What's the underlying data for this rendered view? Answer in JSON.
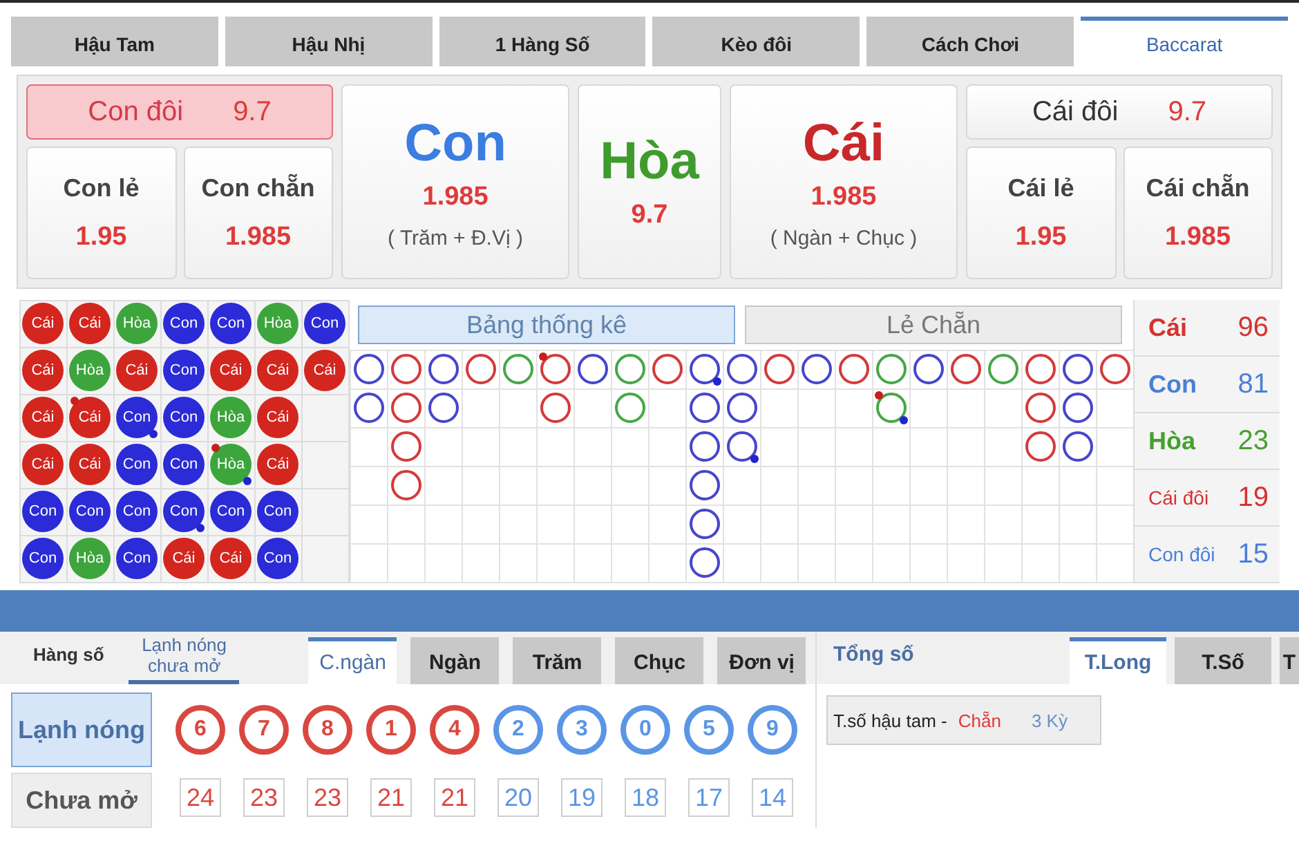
{
  "game_tabs": [
    {
      "label": "Hậu Tam",
      "selected": false
    },
    {
      "label": "Hậu Nhị",
      "selected": false
    },
    {
      "label": "1 Hàng Số",
      "selected": false
    },
    {
      "label": "Kèo đôi",
      "selected": false
    },
    {
      "label": "Cách Chơi",
      "selected": false
    },
    {
      "label": "Baccarat",
      "selected": true
    }
  ],
  "bets": {
    "sides": [
      {
        "pair": {
          "label": "Con đôi",
          "odds": "9.7",
          "selected": true
        },
        "options": [
          {
            "label": "Con lẻ",
            "odds": "1.95"
          },
          {
            "label": "Con chẵn",
            "odds": "1.985"
          }
        ]
      },
      {
        "pair": {
          "label": "Cái đôi",
          "odds": "9.7",
          "selected": false
        },
        "options": [
          {
            "label": "Cái lẻ",
            "odds": "1.95"
          },
          {
            "label": "Cái chẵn",
            "odds": "1.985"
          }
        ]
      }
    ],
    "main": [
      {
        "label": "Con",
        "odds": "1.985",
        "note": "( Trăm + Đ.Vị )",
        "color": "#3b7de0"
      },
      {
        "label": "Hòa",
        "odds": "9.7",
        "color": "#3f9c2c"
      },
      {
        "label": "Cái",
        "odds": "1.985",
        "note": "( Ngàn + Chục )",
        "color": "#c8282a"
      }
    ]
  },
  "road": {
    "bead_plate": {
      "columns": [
        [
          {
            "label": "Cái",
            "color": "#d3261f",
            "banker_pair": false,
            "player_pair": false
          },
          {
            "label": "Cái",
            "color": "#d3261f",
            "banker_pair": false,
            "player_pair": false
          },
          {
            "label": "Cái",
            "color": "#d3261f",
            "banker_pair": false,
            "player_pair": false
          },
          {
            "label": "Cái",
            "color": "#d3261f",
            "banker_pair": false,
            "player_pair": false
          },
          {
            "label": "Con",
            "color": "#2b2bd8",
            "banker_pair": false,
            "player_pair": false
          },
          {
            "label": "Con",
            "color": "#2b2bd8",
            "banker_pair": false,
            "player_pair": false
          }
        ],
        [
          {
            "label": "Cái",
            "color": "#d3261f",
            "banker_pair": false,
            "player_pair": false
          },
          {
            "label": "Hòa",
            "color": "#3ca53c",
            "banker_pair": false,
            "player_pair": false
          },
          {
            "label": "Cái",
            "color": "#d3261f",
            "banker_pair": true,
            "player_pair": false
          },
          {
            "label": "Cái",
            "color": "#d3261f",
            "banker_pair": false,
            "player_pair": false
          },
          {
            "label": "Con",
            "color": "#2b2bd8",
            "banker_pair": false,
            "player_pair": false
          },
          {
            "label": "Hòa",
            "color": "#3ca53c",
            "banker_pair": false,
            "player_pair": false
          }
        ],
        [
          {
            "label": "Hòa",
            "color": "#3ca53c",
            "banker_pair": false,
            "player_pair": false
          },
          {
            "label": "Cái",
            "color": "#d3261f",
            "banker_pair": false,
            "player_pair": false
          },
          {
            "label": "Con",
            "color": "#2b2bd8",
            "banker_pair": false,
            "player_pair": true
          },
          {
            "label": "Con",
            "color": "#2b2bd8",
            "banker_pair": false,
            "player_pair": false
          },
          {
            "label": "Con",
            "color": "#2b2bd8",
            "banker_pair": false,
            "player_pair": false
          },
          {
            "label": "Con",
            "color": "#2b2bd8",
            "banker_pair": false,
            "player_pair": false
          }
        ],
        [
          {
            "label": "Con",
            "color": "#2b2bd8",
            "banker_pair": false,
            "player_pair": false
          },
          {
            "label": "Con",
            "color": "#2b2bd8",
            "banker_pair": false,
            "player_pair": false
          },
          {
            "label": "Con",
            "color": "#2b2bd8",
            "banker_pair": false,
            "player_pair": false
          },
          {
            "label": "Con",
            "color": "#2b2bd8",
            "banker_pair": false,
            "player_pair": false
          },
          {
            "label": "Con",
            "color": "#2b2bd8",
            "banker_pair": false,
            "player_pair": true
          },
          {
            "label": "Cái",
            "color": "#d3261f",
            "banker_pair": false,
            "player_pair": false
          }
        ],
        [
          {
            "label": "Con",
            "color": "#2b2bd8",
            "banker_pair": false,
            "player_pair": false
          },
          {
            "label": "Cái",
            "color": "#d3261f",
            "banker_pair": false,
            "player_pair": false
          },
          {
            "label": "Hòa",
            "color": "#3ca53c",
            "banker_pair": false,
            "player_pair": false
          },
          {
            "label": "Hòa",
            "color": "#3ca53c",
            "banker_pair": true,
            "player_pair": true
          },
          {
            "label": "Con",
            "color": "#2b2bd8",
            "banker_pair": false,
            "player_pair": false
          },
          {
            "label": "Cái",
            "color": "#d3261f",
            "banker_pair": false,
            "player_pair": false
          }
        ],
        [
          {
            "label": "Hòa",
            "color": "#3ca53c",
            "banker_pair": false,
            "player_pair": false
          },
          {
            "label": "Cái",
            "color": "#d3261f",
            "banker_pair": false,
            "player_pair": false
          },
          {
            "label": "Cái",
            "color": "#d3261f",
            "banker_pair": false,
            "player_pair": false
          },
          {
            "label": "Cái",
            "color": "#d3261f",
            "banker_pair": false,
            "player_pair": false
          },
          {
            "label": "Con",
            "color": "#2b2bd8",
            "banker_pair": false,
            "player_pair": false
          },
          {
            "label": "Con",
            "color": "#2b2bd8",
            "banker_pair": false,
            "player_pair": false
          }
        ],
        [
          {
            "label": "Con",
            "color": "#2b2bd8",
            "banker_pair": false,
            "player_pair": false
          },
          {
            "label": "Cái",
            "color": "#d3261f",
            "banker_pair": false,
            "player_pair": false
          }
        ]
      ]
    },
    "road_tabs": [
      {
        "label": "Bảng thống kê",
        "selected": true
      },
      {
        "label": "Lẻ Chẵn",
        "selected": false
      }
    ],
    "big_road": {
      "columns": [
        [
          {
            "color": "#4646cc",
            "banker_pair": false,
            "player_pair": false
          },
          {
            "color": "#4646cc",
            "banker_pair": false,
            "player_pair": false
          }
        ],
        [
          {
            "color": "#d43a3a",
            "banker_pair": false,
            "player_pair": false
          },
          {
            "color": "#d43a3a",
            "banker_pair": false,
            "player_pair": false
          },
          {
            "color": "#d43a3a",
            "banker_pair": false,
            "player_pair": false
          },
          {
            "color": "#d43a3a",
            "banker_pair": false,
            "player_pair": false
          }
        ],
        [
          {
            "color": "#4646cc",
            "banker_pair": false,
            "player_pair": false
          },
          {
            "color": "#4646cc",
            "banker_pair": false,
            "player_pair": false
          }
        ],
        [
          {
            "color": "#d43a3a",
            "banker_pair": false,
            "player_pair": false
          }
        ],
        [
          {
            "color": "#46a846",
            "banker_pair": false,
            "player_pair": false
          }
        ],
        [
          {
            "color": "#d43a3a",
            "banker_pair": true,
            "player_pair": false
          },
          {
            "color": "#d43a3a",
            "banker_pair": false,
            "player_pair": false
          }
        ],
        [
          {
            "color": "#4646cc",
            "banker_pair": false,
            "player_pair": false
          }
        ],
        [
          {
            "color": "#46a846",
            "banker_pair": false,
            "player_pair": false
          },
          {
            "color": "#46a846",
            "banker_pair": false,
            "player_pair": false
          }
        ],
        [
          {
            "color": "#d43a3a",
            "banker_pair": false,
            "player_pair": false
          }
        ],
        [
          {
            "color": "#4646cc",
            "banker_pair": false,
            "player_pair": true
          },
          {
            "color": "#4646cc",
            "banker_pair": false,
            "player_pair": false
          },
          {
            "color": "#4646cc",
            "banker_pair": false,
            "player_pair": false
          },
          {
            "color": "#4646cc",
            "banker_pair": false,
            "player_pair": false
          },
          {
            "color": "#4646cc",
            "banker_pair": false,
            "player_pair": false
          },
          {
            "color": "#4646cc",
            "banker_pair": false,
            "player_pair": false
          }
        ],
        [
          {
            "color": "#4646cc",
            "banker_pair": false,
            "player_pair": false
          },
          {
            "color": "#4646cc",
            "banker_pair": false,
            "player_pair": false
          },
          {
            "color": "#4646cc",
            "banker_pair": false,
            "player_pair": true
          }
        ],
        [
          {
            "color": "#d43a3a",
            "banker_pair": false,
            "player_pair": false
          }
        ],
        [
          {
            "color": "#4646cc",
            "banker_pair": false,
            "player_pair": false
          }
        ],
        [
          {
            "color": "#d43a3a",
            "banker_pair": false,
            "player_pair": false
          }
        ],
        [
          {
            "color": "#46a846",
            "banker_pair": false,
            "player_pair": false
          },
          {
            "color": "#46a846",
            "banker_pair": true,
            "player_pair": true
          }
        ],
        [
          {
            "color": "#4646cc",
            "banker_pair": false,
            "player_pair": false
          }
        ],
        [
          {
            "color": "#d43a3a",
            "banker_pair": false,
            "player_pair": false
          }
        ],
        [
          {
            "color": "#46a846",
            "banker_pair": false,
            "player_pair": false
          }
        ],
        [
          {
            "color": "#d43a3a",
            "banker_pair": false,
            "player_pair": false
          },
          {
            "color": "#d43a3a",
            "banker_pair": false,
            "player_pair": false
          },
          {
            "color": "#d43a3a",
            "banker_pair": false,
            "player_pair": false
          }
        ],
        [
          {
            "color": "#4646cc",
            "banker_pair": false,
            "player_pair": false
          },
          {
            "color": "#4646cc",
            "banker_pair": false,
            "player_pair": false
          },
          {
            "color": "#4646cc",
            "banker_pair": false,
            "player_pair": false
          }
        ],
        [
          {
            "color": "#d43a3a",
            "banker_pair": false,
            "player_pair": false
          }
        ]
      ]
    },
    "totals": [
      {
        "label": "Cái",
        "count": "96",
        "kind": "main",
        "color": "#d63232"
      },
      {
        "label": "Con",
        "count": "81",
        "kind": "main",
        "color": "#4a7fd8"
      },
      {
        "label": "Hòa",
        "count": "23",
        "kind": "main",
        "color": "#45a02f"
      },
      {
        "label": "Cái đôi",
        "count": "19",
        "kind": "pair",
        "color": "#d63232"
      },
      {
        "label": "Con đôi",
        "count": "15",
        "kind": "pair",
        "color": "#4a7fd8"
      }
    ]
  },
  "number_panel": {
    "view_tabs": [
      {
        "label": "Hàng số",
        "selected": false
      },
      {
        "label": "Lạnh nóng chưa mở",
        "selected": true
      }
    ],
    "position_tabs": [
      {
        "label": "C.ngàn",
        "selected": true
      },
      {
        "label": "Ngàn",
        "selected": false
      },
      {
        "label": "Trăm",
        "selected": false
      },
      {
        "label": "Chục",
        "selected": false
      },
      {
        "label": "Đơn vị",
        "selected": false
      }
    ],
    "modes": [
      {
        "label": "Lạnh nóng",
        "selected": true
      },
      {
        "label": "Chưa mở",
        "selected": false
      }
    ],
    "numbers": [
      {
        "digit": "6",
        "count": "24",
        "color": "#d9483f"
      },
      {
        "digit": "7",
        "count": "23",
        "color": "#d9483f"
      },
      {
        "digit": "8",
        "count": "23",
        "color": "#d9483f"
      },
      {
        "digit": "1",
        "count": "21",
        "color": "#d9483f"
      },
      {
        "digit": "4",
        "count": "21",
        "color": "#d9483f"
      },
      {
        "digit": "2",
        "count": "20",
        "color": "#5b95e5"
      },
      {
        "digit": "3",
        "count": "19",
        "color": "#5b95e5"
      },
      {
        "digit": "0",
        "count": "18",
        "color": "#5b95e5"
      },
      {
        "digit": "5",
        "count": "17",
        "color": "#5b95e5"
      },
      {
        "digit": "9",
        "count": "14",
        "color": "#5b95e5"
      }
    ]
  },
  "sum_panel": {
    "title": "Tổng số",
    "tabs": [
      {
        "label": "T.Long",
        "selected": true
      },
      {
        "label": "T.Số",
        "selected": false
      },
      {
        "label": "T",
        "selected": false
      }
    ],
    "streak": {
      "label": "T.số hậu tam -",
      "value": "Chẵn",
      "periods": "3 Kỳ"
    }
  }
}
